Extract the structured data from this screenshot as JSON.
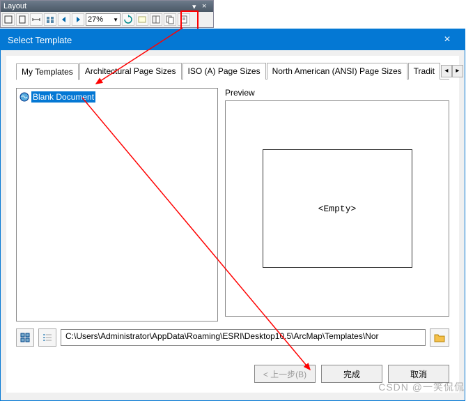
{
  "layout_panel": {
    "title": "Layout",
    "zoom": "27%"
  },
  "dialog": {
    "title": "Select Template"
  },
  "tabs": {
    "items": [
      "My Templates",
      "Architectural Page Sizes",
      "ISO (A) Page Sizes",
      "North American (ANSI) Page Sizes",
      "Tradit"
    ]
  },
  "list": {
    "selected_item": "Blank Document"
  },
  "preview": {
    "label": "Preview",
    "empty_text": "<Empty>"
  },
  "path": {
    "value": "C:\\Users\\Administrator\\AppData\\Roaming\\ESRI\\Desktop10.5\\ArcMap\\Templates\\Nor"
  },
  "wizard": {
    "back": "< 上一步(B)",
    "finish": "完成",
    "cancel": "取消"
  },
  "watermark": "CSDN @一笑侃侃"
}
